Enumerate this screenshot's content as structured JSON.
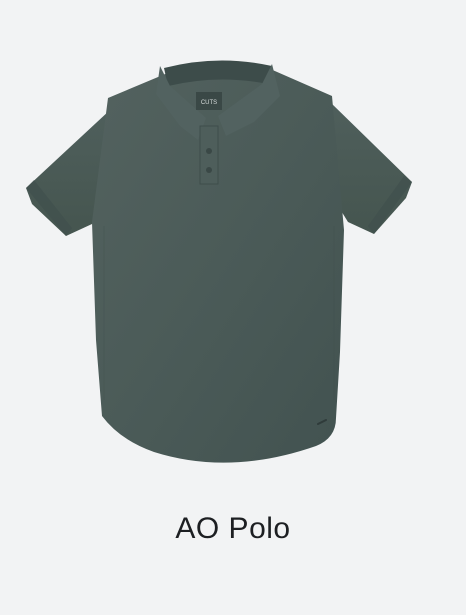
{
  "product": {
    "name": "AO Polo",
    "image": {
      "icon": "polo-shirt",
      "label_text": "CUTS",
      "color": "#4c5d5b"
    }
  },
  "colors": {
    "background": "#f2f3f4",
    "text": "#1d1f22",
    "shirt": "#4c5d5b"
  }
}
